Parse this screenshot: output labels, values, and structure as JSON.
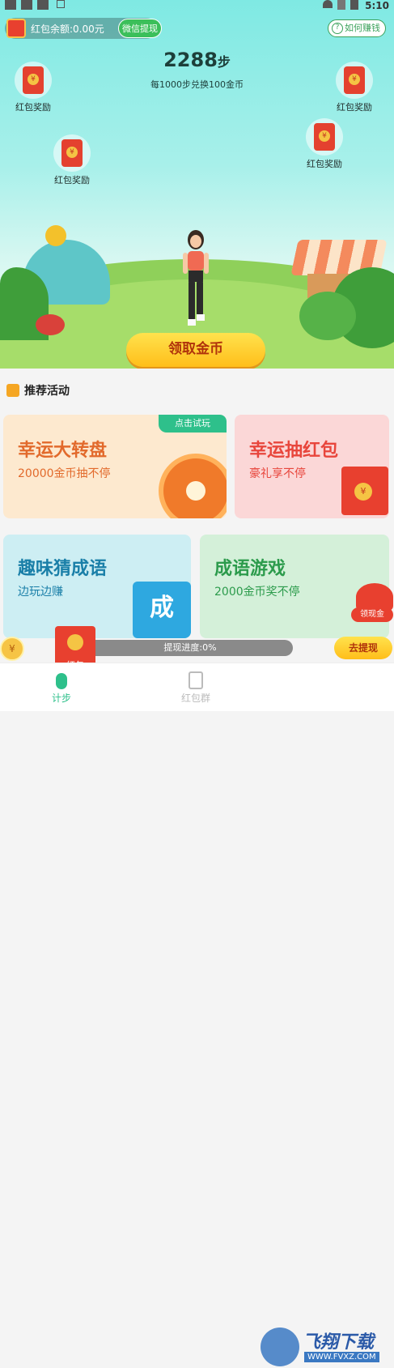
{
  "statusbar": {
    "time": "5:10"
  },
  "header": {
    "balance_label": "红包余额:0.00元",
    "wechat_withdraw": "微信提现",
    "how_to_earn": "如何赚钱",
    "question_mark": "?"
  },
  "steps": {
    "count": "2288",
    "unit": "步",
    "exchange_text": "每1000步兑换100金币"
  },
  "red_packets": [
    {
      "label": "红包奖励"
    },
    {
      "label": "红包奖励"
    },
    {
      "label": "红包奖励"
    },
    {
      "label": "红包奖励"
    }
  ],
  "coin_symbol": "¥",
  "claim_button": "领取金币",
  "recommend": {
    "title": "推荐活动"
  },
  "cards": [
    {
      "title": "幸运大转盘",
      "subtitle": "20000金币抽不停",
      "badge": "点击试玩"
    },
    {
      "title": "幸运抽红包",
      "subtitle": "豪礼享不停"
    },
    {
      "title": "趣味猜成语",
      "subtitle": "边玩边赚",
      "book_char": "成"
    },
    {
      "title": "成语游戏",
      "subtitle": "2000金币奖不停"
    }
  ],
  "progress": {
    "label": "提现进度:0%",
    "value": 0
  },
  "float_red_packet": {
    "label": "红包"
  },
  "withdraw_button": "去提现",
  "cash_badge": "领现金",
  "tabs": [
    {
      "label": "计步"
    },
    {
      "label": "红包群"
    }
  ],
  "watermark": {
    "title": "飞翔下载",
    "url": "WWW.FVXZ.COM"
  },
  "colors": {
    "accent_green": "#2ec08b",
    "claim_yellow": "#ffbe1a",
    "red_packet": "#e8402f"
  }
}
